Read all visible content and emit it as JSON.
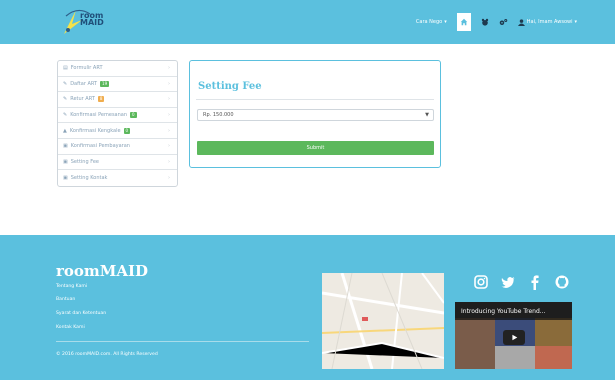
{
  "navbar": {
    "logo_text_line1": "room",
    "logo_text_line2": "MAID",
    "dropdown_label": "Cara Nego",
    "user_name": "Hai, Imam Awsowi",
    "caret": "▾"
  },
  "sidebar": {
    "items": [
      {
        "label": "Formulir ART",
        "badge": ""
      },
      {
        "label": "Daftar ART",
        "badge": "19",
        "badge_color": "#5cb85c"
      },
      {
        "label": "Retur ART",
        "badge": "8",
        "badge_color": "#f0ad4e"
      },
      {
        "label": "Konfirmasi Pemesanan",
        "badge": "0",
        "badge_color": "#5cb85c"
      },
      {
        "label": "Konfirmasi Kengkale",
        "badge": "0",
        "badge_color": "#5cb85c"
      },
      {
        "label": "Konfirmasi Pembayaran",
        "badge": ""
      },
      {
        "label": "Setting Fee",
        "badge": ""
      },
      {
        "label": "Setting Kontak",
        "badge": ""
      }
    ],
    "chevron": "›"
  },
  "panel": {
    "title": "Setting Fee",
    "select_value": "Rp. 150.000",
    "submit_label": "Submit"
  },
  "footer": {
    "brand": "roomMAID",
    "links": [
      "Tentang Kami",
      "Bantuan",
      "Syarat dan Ketentuan",
      "Kontak Kami"
    ],
    "copyright": "© 2016 roomMAID.com. All Rights Reserved",
    "video_title": "Introducing YouTube Trend..."
  },
  "colors": {
    "primary": "#5bc0de",
    "success": "#5cb85c",
    "warning": "#f0ad4e",
    "sidebar_text": "#8aa3b8"
  },
  "icons": {
    "home": "home-icon",
    "notifications": "bear-icon",
    "settings": "gears-icon",
    "user": "user-icon",
    "instagram": "instagram-icon",
    "twitter": "twitter-icon",
    "facebook": "facebook-icon",
    "github": "github-icon"
  }
}
